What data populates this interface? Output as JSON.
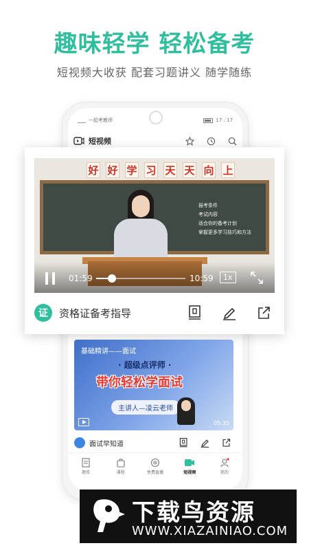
{
  "hero": {
    "title": "趣味轻学 轻松备考",
    "subtitle": "短视频大收获  配套习题讲义  随学随练"
  },
  "phone": {
    "status_carrier": "一起考教师",
    "status_time": "17 : 17",
    "appbar_title": "短视频"
  },
  "video": {
    "banner_chars": [
      "好",
      "好",
      "学",
      "习",
      "天",
      "天",
      "向",
      "上"
    ],
    "board_lines": [
      "报考条件",
      "考试内容",
      "适合你的备考计划",
      "掌握更多学习技巧和方法"
    ],
    "current_time": "01:59",
    "total_time": "10:59",
    "speed": "1x",
    "progress_fraction": 0.18
  },
  "card_footer": {
    "badge": "证",
    "title": "资格证备考指导"
  },
  "card2": {
    "top_text": "基础精讲——面试",
    "sub_text": "· 超级点评师 ·",
    "main_text": "带你轻松学面试",
    "pill_text": "主讲人—凌云老师",
    "duration": "05:35"
  },
  "row2": {
    "title": "面试早知道"
  },
  "tabs": [
    {
      "label": "题库",
      "icon": "book-icon"
    },
    {
      "label": "课程",
      "icon": "bag-icon"
    },
    {
      "label": "免费直播",
      "icon": "live-icon"
    },
    {
      "label": "短视频",
      "icon": "video-icon",
      "active": true
    },
    {
      "label": "我的",
      "icon": "user-icon"
    }
  ],
  "watermark": {
    "title": "下载鸟资源",
    "url": "WWW.XIAZAINIAO.COM"
  },
  "colors": {
    "brand_green": "#2fbf9f",
    "banner_red": "#c9332b",
    "active_tab": "#222222"
  }
}
